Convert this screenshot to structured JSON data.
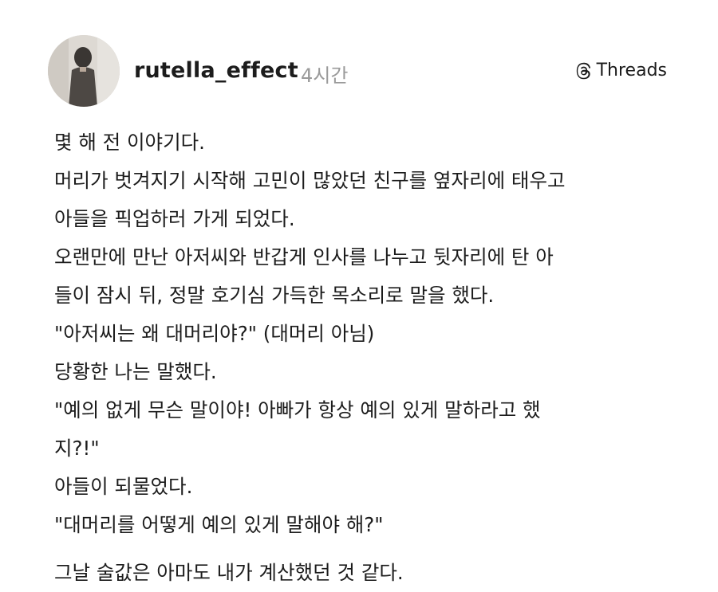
{
  "post": {
    "author": "rutella_effect",
    "time": "4시간",
    "brand": "Threads",
    "lines": [
      "몇 해 전 이야기다.",
      "머리가 벗겨지기 시작해 고민이 많았던 친구를 옆자리에 태우고",
      "아들을 픽업하러 가게 되었다.",
      "오랜만에 만난 아저씨와 반갑게 인사를 나누고 뒷자리에 탄 아",
      "들이 잠시 뒤, 정말 호기심 가득한 목소리로 말을 했다.",
      "\"아저씨는 왜 대머리야?\" (대머리 아님)",
      "당황한 나는 말했다.",
      "\"예의 없게 무슨 말이야! 아빠가 항상 예의 있게 말하라고 했",
      "지?!\"",
      "아들이 되물었다.",
      "\"대머리를 어떻게 예의 있게 말해야 해?\"",
      "그날 술값은 아마도 내가 계산했던 것 같다."
    ]
  },
  "icons": {
    "avatar": "profile-photo",
    "threads": "threads-logo-icon"
  }
}
